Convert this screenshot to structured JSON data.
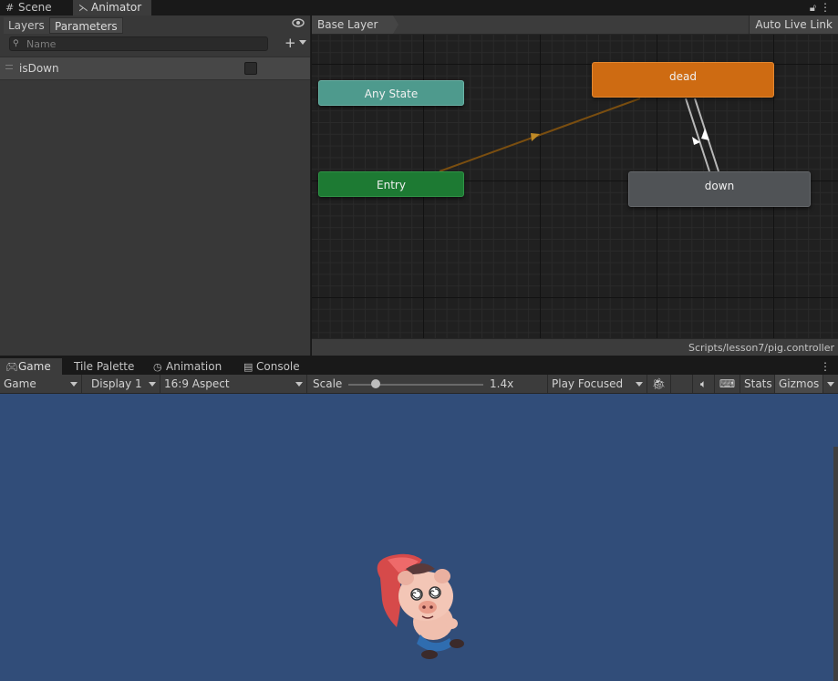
{
  "top_tabs": [
    {
      "icon": "grid-icon",
      "label": "Scene"
    },
    {
      "icon": "animator-icon",
      "label": "Animator"
    }
  ],
  "animator": {
    "segments": {
      "layers": "Layers",
      "parameters": "Parameters"
    },
    "search_placeholder": "Name",
    "parameters": [
      {
        "name": "isDown",
        "type": "bool",
        "value": false
      }
    ],
    "breadcrumb": "Base Layer",
    "auto_live_link": "Auto Live Link",
    "states": {
      "any": "Any State",
      "entry": "Entry",
      "dead": "dead",
      "down": "down"
    },
    "asset_path": "Scripts/lesson7/pig.controller",
    "colors": {
      "dead": "#ce6b12",
      "entry": "#1d7a33",
      "any": "#4e9a8d",
      "down": "#505356",
      "transition_default": "#8a5a12"
    }
  },
  "bottom_tabs": [
    {
      "icon": "gamepad-icon",
      "label": "Game"
    },
    {
      "icon": "",
      "label": "Tile Palette"
    },
    {
      "icon": "clock-icon",
      "label": "Animation"
    },
    {
      "icon": "console-icon",
      "label": "Console"
    }
  ],
  "game_toolbar": {
    "mode": "Game",
    "display": "Display 1",
    "aspect": "16:9 Aspect",
    "scale_label": "Scale",
    "scale_value": "1.4x",
    "scale_fraction": 0.2,
    "play_mode": "Play Focused",
    "stats": "Stats",
    "gizmos": "Gizmos"
  },
  "game_view": {
    "background": "#314d79",
    "character": "pig-character"
  }
}
